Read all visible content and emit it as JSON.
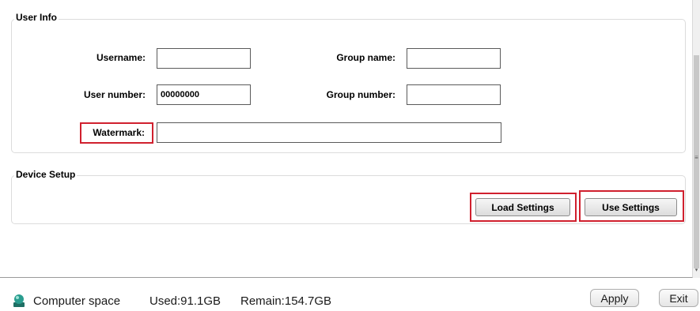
{
  "user_info": {
    "title": "User Info",
    "username_label": "Username:",
    "username_value": "",
    "group_name_label": "Group name:",
    "group_name_value": "",
    "user_number_label": "User number:",
    "user_number_value": "00000000",
    "group_number_label": "Group number:",
    "group_number_value": "",
    "watermark_label": "Watermark:",
    "watermark_value": ""
  },
  "device_setup": {
    "title": "Device Setup",
    "load_label": "Load Settings",
    "use_label": "Use Settings"
  },
  "status": {
    "icon": "disk-icon",
    "computer_space": "Computer space",
    "used": "Used:91.1GB",
    "remain": "Remain:154.7GB"
  },
  "footer": {
    "apply_label": "Apply",
    "exit_label": "Exit"
  },
  "colors": {
    "highlight": "#d0202e",
    "disk_icon": "#2a9d8f"
  }
}
